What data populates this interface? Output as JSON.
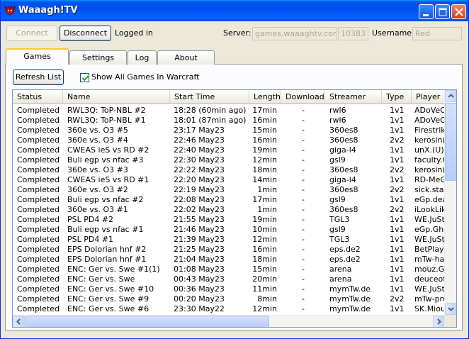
{
  "window": {
    "title": "Waaagh!TV"
  },
  "toolbar": {
    "connect_label": "Connect",
    "disconnect_label": "Disconnect",
    "status": "Logged in",
    "server_label": "Server:",
    "server_value": "games.waaaghtv.com",
    "port_value": "10383",
    "username_label": "Username:",
    "username_value": "Red"
  },
  "tabs": [
    "Games",
    "Settings",
    "Log",
    "About"
  ],
  "games_tab": {
    "refresh_label": "Refresh List",
    "show_all_label": "Show All Games In Warcraft",
    "show_all_checked": true
  },
  "table": {
    "columns": [
      "Status",
      "Name",
      "Start Time",
      "Length",
      "Download",
      "Streamer",
      "Type",
      "Player"
    ],
    "rows": [
      [
        "Completed",
        "RWL3Q: ToP-NBL #2",
        "18:28 (60min ago)",
        "17min",
        "-",
        "rwl6",
        "1v1",
        "ADoVeOVe"
      ],
      [
        "Completed",
        "RWL3Q: ToP-NBL #1",
        "18:01 (87min ago)",
        "16min",
        "-",
        "rwl6",
        "1v1",
        "ADoVeOVe"
      ],
      [
        "Completed",
        "360e vs. O3 #5",
        "23:17 May23",
        "15min",
        "-",
        "360es8",
        "1v1",
        "Firestrike"
      ],
      [
        "Completed",
        "360e vs. O3 #4",
        "22:46 May23",
        "16min",
        "-",
        "360es8",
        "2v2",
        "kerosin(N"
      ],
      [
        "Completed",
        "CWEAS ieS vs RD #2",
        "22:40 May23",
        "19min",
        "-",
        "giga-l4",
        "1v1",
        "unX.(U) -"
      ],
      [
        "Completed",
        "Buli egp vs nfac #3",
        "22:30 May23",
        "12min",
        "-",
        "gsl9",
        "1v1",
        "faculty.C"
      ],
      [
        "Completed",
        "360e vs. O3 #3",
        "22:22 May23",
        "18min",
        "-",
        "360es8",
        "2v2",
        "kerosin(N"
      ],
      [
        "Completed",
        "CWEAS ieS vs RD #1",
        "22:20 May23",
        "14min",
        "-",
        "giga-l4",
        "1v1",
        "RD-MeGa"
      ],
      [
        "Completed",
        "360e vs. O3 #2",
        "22:19 May23",
        "1min",
        "-",
        "360es8",
        "2v2",
        "sick.sta(U"
      ],
      [
        "Completed",
        "Buli egp vs nfac #2",
        "22:08 May23",
        "17min",
        "-",
        "gsl9",
        "1v1",
        "eGp.dea"
      ],
      [
        "Completed",
        "360e vs. O3 #1",
        "22:02 May23",
        "1min",
        "-",
        "360es8",
        "2v2",
        "iLookLikE"
      ],
      [
        "Completed",
        "PSL PD4 #2",
        "21:55 May23",
        "19min",
        "-",
        "TGL3",
        "1v1",
        "WE.JuSt"
      ],
      [
        "Completed",
        "Buli egp vs nfac #1",
        "21:46 May23",
        "10min",
        "-",
        "gsl9",
        "1v1",
        "eGp.Gh0"
      ],
      [
        "Completed",
        "PSL PD4 #1",
        "21:39 May23",
        "12min",
        "-",
        "TGL3",
        "1v1",
        "WE.JuSt"
      ],
      [
        "Completed",
        "EPS Dolorian hnf #2",
        "21:25 May23",
        "16min",
        "-",
        "eps.de2",
        "1v1",
        "BetPlaye"
      ],
      [
        "Completed",
        "EPS Dolorian hnf #1",
        "21:04 May23",
        "18min",
        "-",
        "eps.de2",
        "1v1",
        "mTw-har"
      ],
      [
        "Completed",
        "ENC: Ger vs. Swe #1(1)",
        "01:08 May23",
        "15min",
        "-",
        "arena",
        "1v1",
        "mouz.Ge"
      ],
      [
        "Completed",
        "ENC: Ger vs. Swe",
        "00:43 May23",
        "20min",
        "-",
        "arena",
        "1v1",
        "deuceofc"
      ],
      [
        "Completed",
        "ENC: Ger vs. Swe #10",
        "00:36 May23",
        "11min",
        "-",
        "mymTw.de",
        "1v1",
        "WE.JuSt"
      ],
      [
        "Completed",
        "ENC: Ger vs. Swe #9",
        "00:20 May23",
        "8min",
        "-",
        "mymTw.de",
        "2v2",
        "mTw-pro"
      ],
      [
        "Completed",
        "ENC: Ger vs. Swe #6",
        "23:30 May22",
        "12min",
        "-",
        "mymTw.de",
        "1v1",
        "SK.Miou("
      ]
    ]
  }
}
